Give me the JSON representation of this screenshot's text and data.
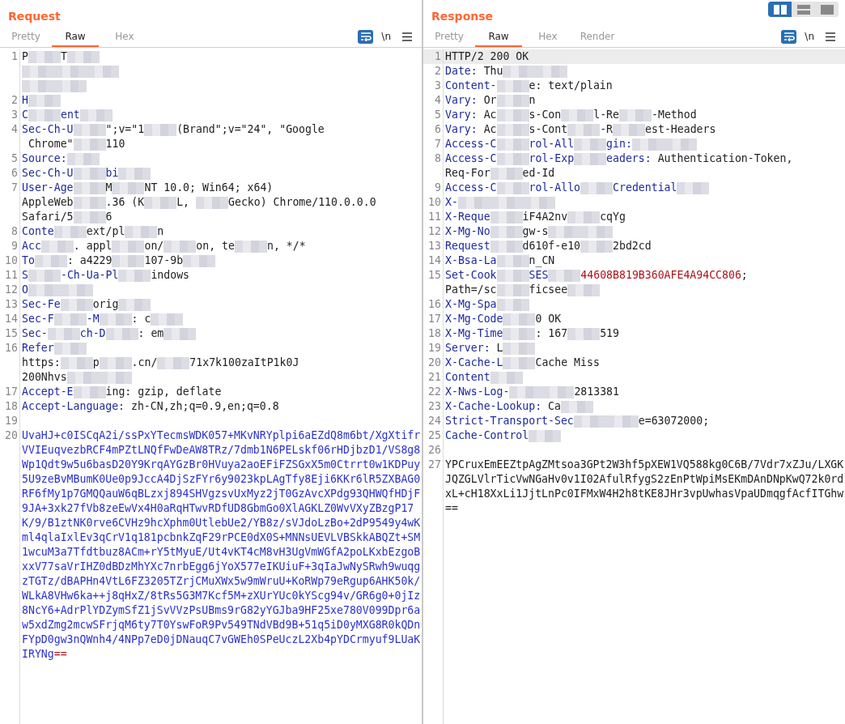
{
  "layout_toggle": [
    {
      "selected": true
    },
    {
      "selected": false
    },
    {
      "selected": false
    }
  ],
  "panes": [
    {
      "title": "Request",
      "tabs": [
        {
          "label": "Pretty",
          "selected": false
        },
        {
          "label": "Raw",
          "selected": true
        },
        {
          "label": "Hex",
          "selected": false
        }
      ],
      "wrap_on": true,
      "newline_label": "\\n",
      "lines": [
        {
          "number": "1",
          "highlighted": false,
          "parts": [
            {
              "kind": "value",
              "text": "P"
            },
            {
              "kind": "redacted"
            },
            {
              "kind": "value",
              "text": "T"
            },
            {
              "kind": "redacted"
            }
          ]
        },
        {
          "highlighted": false,
          "parts": [
            {
              "kind": "redacted"
            },
            {
              "kind": "redacted"
            },
            {
              "kind": "redacted"
            }
          ]
        },
        {
          "highlighted": false,
          "parts": [
            {
              "kind": "redacted"
            },
            {
              "kind": "redacted"
            }
          ]
        },
        {
          "number": "2",
          "highlighted": false,
          "parts": [
            {
              "kind": "key",
              "text": "H"
            },
            {
              "kind": "redacted"
            }
          ]
        },
        {
          "number": "3",
          "highlighted": false,
          "parts": [
            {
              "kind": "key",
              "text": "C"
            },
            {
              "kind": "redacted"
            },
            {
              "kind": "key",
              "text": "ent"
            },
            {
              "kind": "redacted"
            }
          ]
        },
        {
          "number": "4",
          "highlighted": false,
          "parts": [
            {
              "kind": "key",
              "text": "Sec-Ch-U"
            },
            {
              "kind": "redacted"
            },
            {
              "kind": "value",
              "text": "\";v=\"1"
            },
            {
              "kind": "redacted"
            },
            {
              "kind": "value",
              "text": "(Brand\";v=\"24\", \"Google"
            }
          ]
        },
        {
          "highlighted": false,
          "parts": [
            {
              "kind": "value",
              "text": " Chrome\""
            },
            {
              "kind": "redacted"
            },
            {
              "kind": "value",
              "text": "110"
            }
          ]
        },
        {
          "number": "5",
          "highlighted": false,
          "parts": [
            {
              "kind": "key",
              "text": "Source:"
            },
            {
              "kind": "redacted"
            }
          ]
        },
        {
          "number": "6",
          "highlighted": false,
          "parts": [
            {
              "kind": "key",
              "text": "Sec-Ch-U"
            },
            {
              "kind": "redacted"
            },
            {
              "kind": "key",
              "text": "bi"
            },
            {
              "kind": "redacted"
            }
          ]
        },
        {
          "number": "7",
          "highlighted": false,
          "parts": [
            {
              "kind": "key",
              "text": "User-Age"
            },
            {
              "kind": "redacted"
            },
            {
              "kind": "value",
              "text": "M"
            },
            {
              "kind": "redacted"
            },
            {
              "kind": "value",
              "text": "NT 10.0; Win64; x64)"
            }
          ]
        },
        {
          "highlighted": false,
          "parts": [
            {
              "kind": "value",
              "text": "AppleWeb"
            },
            {
              "kind": "redacted"
            },
            {
              "kind": "value",
              "text": ".36 (K"
            },
            {
              "kind": "redacted"
            },
            {
              "kind": "value",
              "text": "L, "
            },
            {
              "kind": "redacted"
            },
            {
              "kind": "value",
              "text": "Gecko) Chrome/110.0.0.0"
            }
          ]
        },
        {
          "highlighted": false,
          "parts": [
            {
              "kind": "value",
              "text": "Safari/5"
            },
            {
              "kind": "redacted"
            },
            {
              "kind": "value",
              "text": "6"
            }
          ]
        },
        {
          "number": "8",
          "highlighted": false,
          "parts": [
            {
              "kind": "key",
              "text": "Conte"
            },
            {
              "kind": "redacted"
            },
            {
              "kind": "value",
              "text": "ext/pl"
            },
            {
              "kind": "redacted"
            },
            {
              "kind": "value",
              "text": "n"
            }
          ]
        },
        {
          "number": "9",
          "highlighted": false,
          "parts": [
            {
              "kind": "key",
              "text": "Acc"
            },
            {
              "kind": "redacted"
            },
            {
              "kind": "value",
              "text": ". appl"
            },
            {
              "kind": "redacted"
            },
            {
              "kind": "value",
              "text": "on/"
            },
            {
              "kind": "redacted"
            },
            {
              "kind": "value",
              "text": "on, te"
            },
            {
              "kind": "redacted"
            },
            {
              "kind": "value",
              "text": "n, */*"
            }
          ]
        },
        {
          "number": "10",
          "highlighted": false,
          "parts": [
            {
              "kind": "key",
              "text": "To"
            },
            {
              "kind": "redacted"
            },
            {
              "kind": "value",
              "text": ": a4229"
            },
            {
              "kind": "redacted"
            },
            {
              "kind": "value",
              "text": "107-9b"
            },
            {
              "kind": "redacted"
            }
          ]
        },
        {
          "number": "11",
          "highlighted": false,
          "parts": [
            {
              "kind": "key",
              "text": "S"
            },
            {
              "kind": "redacted"
            },
            {
              "kind": "key",
              "text": "-Ch-Ua-Pl"
            },
            {
              "kind": "redacted"
            },
            {
              "kind": "value",
              "text": "indows"
            }
          ]
        },
        {
          "number": "12",
          "highlighted": false,
          "parts": [
            {
              "kind": "key",
              "text": "O"
            },
            {
              "kind": "redacted"
            },
            {
              "kind": "redacted"
            }
          ]
        },
        {
          "number": "13",
          "highlighted": false,
          "parts": [
            {
              "kind": "key",
              "text": "Sec-Fe"
            },
            {
              "kind": "redacted"
            },
            {
              "kind": "value",
              "text": "orig"
            },
            {
              "kind": "redacted"
            }
          ]
        },
        {
          "number": "14",
          "highlighted": false,
          "parts": [
            {
              "kind": "key",
              "text": "Sec-F"
            },
            {
              "kind": "redacted"
            },
            {
              "kind": "key",
              "text": "-M"
            },
            {
              "kind": "redacted"
            },
            {
              "kind": "value",
              "text": ": c"
            },
            {
              "kind": "redacted"
            }
          ]
        },
        {
          "number": "15",
          "highlighted": false,
          "parts": [
            {
              "kind": "key",
              "text": "Sec-"
            },
            {
              "kind": "redacted"
            },
            {
              "kind": "key",
              "text": "ch-D"
            },
            {
              "kind": "redacted"
            },
            {
              "kind": "value",
              "text": ": em"
            },
            {
              "kind": "redacted"
            }
          ]
        },
        {
          "number": "16",
          "highlighted": false,
          "parts": [
            {
              "kind": "key",
              "text": "Refer"
            },
            {
              "kind": "redacted"
            }
          ]
        },
        {
          "highlighted": false,
          "parts": [
            {
              "kind": "value",
              "text": "https:"
            },
            {
              "kind": "redacted"
            },
            {
              "kind": "value",
              "text": "p"
            },
            {
              "kind": "redacted"
            },
            {
              "kind": "value",
              "text": ".cn/"
            },
            {
              "kind": "redacted"
            },
            {
              "kind": "value",
              "text": "71x7k100zaItP1k0J"
            }
          ]
        },
        {
          "highlighted": false,
          "parts": [
            {
              "kind": "value",
              "text": "200Nhvs"
            },
            {
              "kind": "redacted"
            },
            {
              "kind": "redacted"
            }
          ]
        },
        {
          "number": "17",
          "highlighted": false,
          "parts": [
            {
              "kind": "key",
              "text": "Accept-E"
            },
            {
              "kind": "redacted"
            },
            {
              "kind": "value",
              "text": "ing: gzip, deflate"
            }
          ]
        },
        {
          "number": "18",
          "highlighted": false,
          "parts": [
            {
              "kind": "key",
              "text": "Accept-Language:"
            },
            {
              "kind": "value",
              "text": " zh-CN,zh;q=0.9,en;q=0.8"
            }
          ]
        },
        {
          "number": "19",
          "highlighted": false
        },
        {
          "number": "20",
          "highlighted": false,
          "kind": "body",
          "parts": [
            {
              "kind": "param",
              "text": "UvaHJ+c0ISCqA2i/ssPxYTecmsWDK057+MKvNRYplpi6aEZdQ8m6bt/XgXtifrVVIEuqvezbRCF4mPZtLNQfFwDeAW8TRz/7dmb1N6PELskf06rHDjbzD1/VS8g8Wp1Qdt9w5u6basD20Y9KrqAYGzBr0HVuya2aoEFiFZSGxX5m0Ctrrt0w1KDPuy5U9zeBvMBumK0Ue0p9JccA4DjSzFYr6y9023kpLAgTfy8Eji6KKr6lR5ZXBAG0RF6fMy1p7GMQQauW6qBLzxj894SHVgzsvUxMyz2jT0GzAvcXPdg93QHWQfHDjF9JA+3xk27fVb8zeEwVx4H0aRqHTwvRDfUD8GbmGo0XlAGKLZ0WvVXyZBzgP17K/9/B1ztNK0rve6CVHz9hcXphm0UtlebUe2/YB8z/sVJdoLzBo+2dP9549y4wKml4qlaIxlEv3qCrV1q181pcbnkZqF29rPCE0dX0S+MNNsUEVLVBSkkABQZt+SM1wcuM3a7Tfdtbuz8ACm+rY5tMyuE/Ut4vKT4cM8vH3UgVmWGfA2poLKxbEzgoBxxV77saVrIHZ0dBDzMhYXc7nrbEgg6jYoX577eIKUiuF+3qIaJwNySRwh9wuqgzTGTz/dBAPHn4VtL6FZ3205TZrjCMuXWx5w9mWruU+KoRWp79eRgup6AHK50k/WLkA8VHw6ka++j8qHxZ/8tRs5G3M7Kcf5M+zXUrYUc0kYScg94v/GR6g0+0jIz8NcY6+AdrPlYDZymSfZ1jSvVVzPsUBms9rG82yYGJba9HF25xe780V099Dpr6aw5xdZmg2mcwSFrjqM6ty7T0YswFoR9Pv549TNdVBd9B+51q5iD0yMXG8R0kQDnFYpD0gw3nQWnh4/4NPp7eD0jDNauqC7vGWEh0SPeUczL2Xb4pYDCrmyuf9LUaKIRYNg"
            },
            {
              "kind": "cookie",
              "text": "=="
            }
          ]
        }
      ]
    },
    {
      "title": "Response",
      "tabs": [
        {
          "label": "Pretty",
          "selected": false
        },
        {
          "label": "Raw",
          "selected": true
        },
        {
          "label": "Hex",
          "selected": false
        },
        {
          "label": "Render",
          "selected": false
        }
      ],
      "wrap_on": true,
      "newline_label": "\\n",
      "lines": [
        {
          "number": "1",
          "highlighted": true,
          "parts": [
            {
              "kind": "value",
              "text": "HTTP/2 200 OK"
            }
          ]
        },
        {
          "number": "2",
          "highlighted": false,
          "parts": [
            {
              "kind": "key",
              "text": "Date:"
            },
            {
              "kind": "value",
              "text": " Thu"
            },
            {
              "kind": "redacted"
            },
            {
              "kind": "redacted"
            }
          ]
        },
        {
          "number": "3",
          "highlighted": false,
          "parts": [
            {
              "kind": "key",
              "text": "Content-"
            },
            {
              "kind": "redacted"
            },
            {
              "kind": "value",
              "text": "e: text/plain"
            }
          ]
        },
        {
          "number": "4",
          "highlighted": false,
          "parts": [
            {
              "kind": "key",
              "text": "Vary:"
            },
            {
              "kind": "value",
              "text": " Or"
            },
            {
              "kind": "redacted"
            },
            {
              "kind": "value",
              "text": "n"
            }
          ]
        },
        {
          "number": "5",
          "highlighted": false,
          "parts": [
            {
              "kind": "key",
              "text": "Vary:"
            },
            {
              "kind": "value",
              "text": " Ac"
            },
            {
              "kind": "redacted"
            },
            {
              "kind": "value",
              "text": "s-Con"
            },
            {
              "kind": "redacted"
            },
            {
              "kind": "value",
              "text": "l-Re"
            },
            {
              "kind": "redacted"
            },
            {
              "kind": "value",
              "text": "-Method"
            }
          ]
        },
        {
          "number": "6",
          "highlighted": false,
          "parts": [
            {
              "kind": "key",
              "text": "Vary:"
            },
            {
              "kind": "value",
              "text": " Ac"
            },
            {
              "kind": "redacted"
            },
            {
              "kind": "value",
              "text": "s-Cont"
            },
            {
              "kind": "redacted"
            },
            {
              "kind": "value",
              "text": "-R"
            },
            {
              "kind": "redacted"
            },
            {
              "kind": "value",
              "text": "est-Headers"
            }
          ]
        },
        {
          "number": "7",
          "highlighted": false,
          "parts": [
            {
              "kind": "key",
              "text": "Access-C"
            },
            {
              "kind": "redacted"
            },
            {
              "kind": "key",
              "text": "rol-All"
            },
            {
              "kind": "redacted"
            },
            {
              "kind": "key",
              "text": "gin:"
            },
            {
              "kind": "redacted"
            },
            {
              "kind": "redacted"
            }
          ]
        },
        {
          "number": "8",
          "highlighted": false,
          "parts": [
            {
              "kind": "key",
              "text": "Access-C"
            },
            {
              "kind": "redacted"
            },
            {
              "kind": "key",
              "text": "rol-Exp"
            },
            {
              "kind": "redacted"
            },
            {
              "kind": "key",
              "text": "eaders:"
            },
            {
              "kind": "value",
              "text": " Authentication-Token,"
            }
          ]
        },
        {
          "highlighted": false,
          "parts": [
            {
              "kind": "value",
              "text": "Req-For"
            },
            {
              "kind": "redacted"
            },
            {
              "kind": "value",
              "text": "ed-Id"
            }
          ]
        },
        {
          "number": "9",
          "highlighted": false,
          "parts": [
            {
              "kind": "key",
              "text": "Access-C"
            },
            {
              "kind": "redacted"
            },
            {
              "kind": "key",
              "text": "rol-Allo"
            },
            {
              "kind": "redacted"
            },
            {
              "kind": "key",
              "text": "Credential"
            },
            {
              "kind": "redacted"
            }
          ]
        },
        {
          "number": "10",
          "highlighted": false,
          "parts": [
            {
              "kind": "key",
              "text": "X-"
            },
            {
              "kind": "redacted"
            },
            {
              "kind": "redacted"
            },
            {
              "kind": "redacted"
            }
          ]
        },
        {
          "number": "11",
          "highlighted": false,
          "parts": [
            {
              "kind": "key",
              "text": "X-Reque"
            },
            {
              "kind": "redacted"
            },
            {
              "kind": "value",
              "text": "iF4A2nv"
            },
            {
              "kind": "redacted"
            },
            {
              "kind": "value",
              "text": "cqYg"
            }
          ]
        },
        {
          "number": "12",
          "highlighted": false,
          "parts": [
            {
              "kind": "key",
              "text": "X-Mg-No"
            },
            {
              "kind": "redacted"
            },
            {
              "kind": "value",
              "text": "gw-s"
            },
            {
              "kind": "redacted"
            },
            {
              "kind": "redacted"
            }
          ]
        },
        {
          "number": "13",
          "highlighted": false,
          "parts": [
            {
              "kind": "key",
              "text": "Request"
            },
            {
              "kind": "redacted"
            },
            {
              "kind": "value",
              "text": "d610f-e10"
            },
            {
              "kind": "redacted"
            },
            {
              "kind": "value",
              "text": "2bd2cd"
            }
          ]
        },
        {
          "number": "14",
          "highlighted": false,
          "parts": [
            {
              "kind": "key",
              "text": "X-Bsa-La"
            },
            {
              "kind": "redacted"
            },
            {
              "kind": "value",
              "text": "n_CN"
            }
          ]
        },
        {
          "number": "15",
          "highlighted": false,
          "parts": [
            {
              "kind": "key",
              "text": "Set-Cook"
            },
            {
              "kind": "redacted"
            },
            {
              "kind": "key",
              "text": "SES"
            },
            {
              "kind": "redacted"
            },
            {
              "kind": "cookie",
              "text": "44608B819B360AFE4A94CC806"
            },
            {
              "kind": "value",
              "text": ";"
            }
          ]
        },
        {
          "highlighted": false,
          "parts": [
            {
              "kind": "value",
              "text": "Path=/sc"
            },
            {
              "kind": "redacted"
            },
            {
              "kind": "value",
              "text": "ficsee"
            },
            {
              "kind": "redacted"
            }
          ]
        },
        {
          "number": "16",
          "highlighted": false,
          "parts": [
            {
              "kind": "key",
              "text": "X-Mg-Spa"
            },
            {
              "kind": "redacted"
            }
          ]
        },
        {
          "number": "17",
          "highlighted": false,
          "parts": [
            {
              "kind": "key",
              "text": "X-Mg-Code"
            },
            {
              "kind": "redacted"
            },
            {
              "kind": "value",
              "text": "0 OK"
            }
          ]
        },
        {
          "number": "18",
          "highlighted": false,
          "parts": [
            {
              "kind": "key",
              "text": "X-Mg-Time"
            },
            {
              "kind": "redacted"
            },
            {
              "kind": "value",
              "text": ": 167"
            },
            {
              "kind": "redacted"
            },
            {
              "kind": "value",
              "text": "519"
            }
          ]
        },
        {
          "number": "19",
          "highlighted": false,
          "parts": [
            {
              "kind": "key",
              "text": "Server:"
            },
            {
              "kind": "value",
              "text": " L"
            },
            {
              "kind": "redacted"
            }
          ]
        },
        {
          "number": "20",
          "highlighted": false,
          "parts": [
            {
              "kind": "key",
              "text": "X-Cache-L"
            },
            {
              "kind": "redacted"
            },
            {
              "kind": "value",
              "text": "Cache Miss"
            }
          ]
        },
        {
          "number": "21",
          "highlighted": false,
          "parts": [
            {
              "kind": "key",
              "text": "Content"
            },
            {
              "kind": "redacted"
            }
          ]
        },
        {
          "number": "22",
          "highlighted": false,
          "parts": [
            {
              "kind": "key",
              "text": "X-Nws-Log-"
            },
            {
              "kind": "redacted"
            },
            {
              "kind": "redacted"
            },
            {
              "kind": "value",
              "text": "2813381"
            }
          ]
        },
        {
          "number": "23",
          "highlighted": false,
          "parts": [
            {
              "kind": "key",
              "text": "X-Cache-Lookup:"
            },
            {
              "kind": "value",
              "text": " Ca"
            },
            {
              "kind": "redacted"
            }
          ]
        },
        {
          "number": "24",
          "highlighted": false,
          "parts": [
            {
              "kind": "key",
              "text": "Strict-Transport-Sec"
            },
            {
              "kind": "redacted"
            },
            {
              "kind": "redacted"
            },
            {
              "kind": "value",
              "text": "e=63072000;"
            }
          ]
        },
        {
          "number": "25",
          "highlighted": false,
          "parts": [
            {
              "kind": "key",
              "text": "Cache-Control"
            },
            {
              "kind": "redacted"
            }
          ]
        },
        {
          "number": "26",
          "highlighted": false
        },
        {
          "number": "27",
          "highlighted": false,
          "kind": "body",
          "parts": [
            {
              "kind": "value",
              "text": "YPCruxEmEEZtpAgZMtsoa3GPt2W3hf5pXEW1VQ588kg0C6B/7Vdr7xZJu/LXGKJQZGLVlrTicVwNGaHv0v1I02AfulRfygS2zEnPtWpiMsEKmDAnDNpKwQ72k0rdxL+cH18XxLi1JjtLnPc0IFMxW4H2h8tKE8JHr3vpUwhasVpaUDmqgfAcfITGhw=="
            }
          ]
        }
      ]
    }
  ]
}
